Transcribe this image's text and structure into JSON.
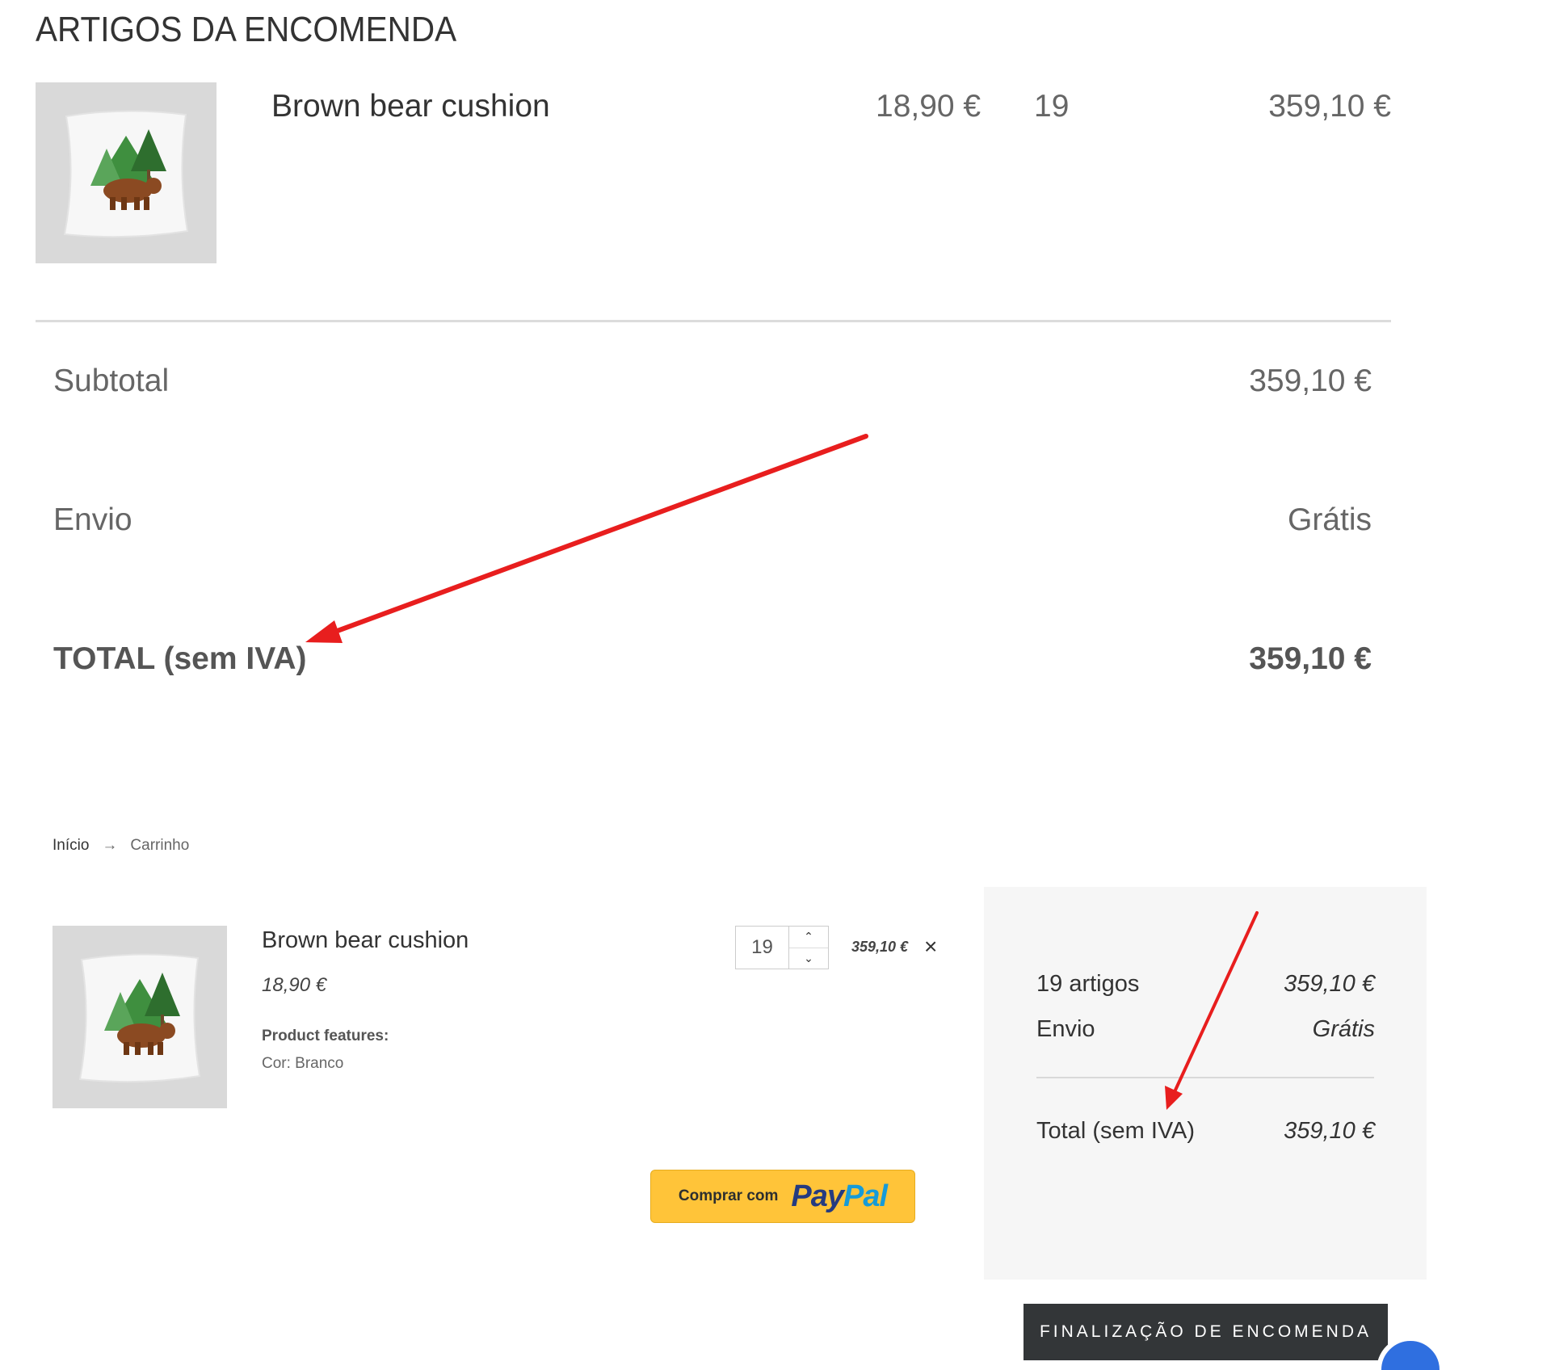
{
  "order": {
    "title": "ARTIGOS DA ENCOMENDA",
    "item": {
      "name": "Brown bear cushion",
      "unit_price": "18,90 €",
      "quantity": "19",
      "line_total": "359,10 €"
    },
    "summary": {
      "subtotal_label": "Subtotal",
      "subtotal_value": "359,10 €",
      "shipping_label": "Envio",
      "shipping_value": "Grátis",
      "total_label": "TOTAL (sem IVA)",
      "total_value": "359,10 €"
    }
  },
  "breadcrumb": {
    "home": "Início",
    "separator": "→",
    "current": "Carrinho"
  },
  "cart": {
    "item": {
      "name": "Brown bear cushion",
      "unit_price": "18,90 €",
      "features_label": "Product features:",
      "features_value": "Cor: Branco",
      "quantity": "19",
      "line_total": "359,10 €",
      "remove_symbol": "×",
      "stepper_up": "⌃",
      "stepper_down": "⌄"
    },
    "paypal": {
      "lead_text": "Comprar com",
      "brand_part1": "Pay",
      "brand_part2": "Pal"
    },
    "summary": {
      "items_label": "19 artigos",
      "items_value": "359,10 €",
      "shipping_label": "Envio",
      "shipping_value": "Grátis",
      "total_label": "Total (sem IVA)",
      "total_value": "359,10 €"
    },
    "checkout_label": "FINALIZAÇÃO DE ENCOMENDA"
  },
  "colors": {
    "annotation_arrow": "#e81e1e",
    "paypal_yellow": "#ffc439",
    "paypal_dark_blue": "#253b80",
    "paypal_light_blue": "#179bd7",
    "checkout_button": "#333638",
    "summary_panel": "#f6f6f6"
  },
  "icons": {
    "product_thumbnail": "bear-cushion-image",
    "remove": "close-icon",
    "stepper_up": "chevron-up-icon",
    "stepper_down": "chevron-down-icon",
    "chat": "chat-bubble-icon"
  }
}
